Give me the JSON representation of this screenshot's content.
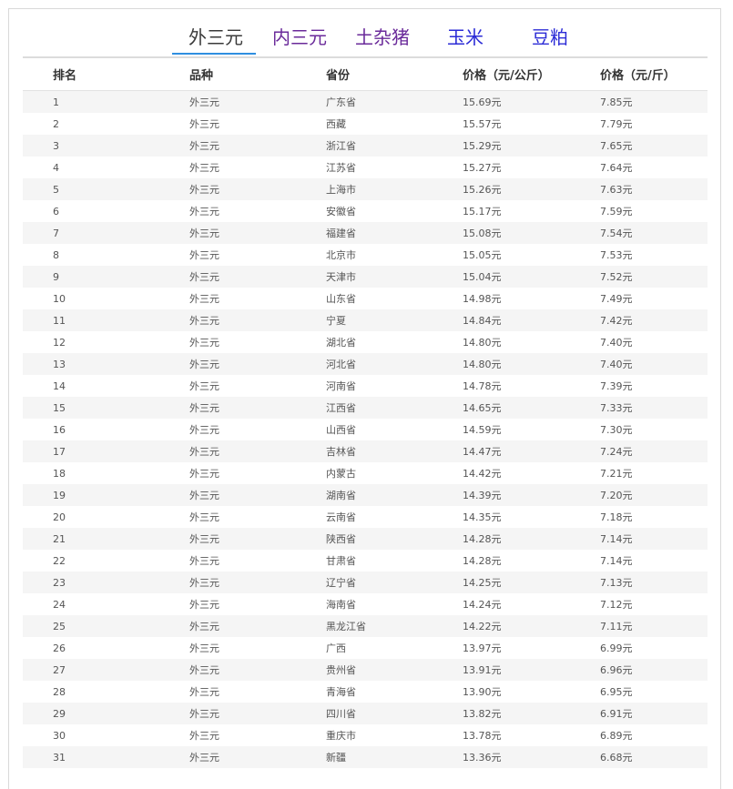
{
  "tabs": [
    {
      "label": "外三元"
    },
    {
      "label": "内三元"
    },
    {
      "label": "土杂猪"
    },
    {
      "label": "玉米"
    },
    {
      "label": "豆粕"
    }
  ],
  "table": {
    "headers": [
      "排名",
      "品种",
      "省份",
      "价格（元/公斤）",
      "价格（元/斤）"
    ],
    "rows": [
      [
        "1",
        "外三元",
        "广东省",
        "15.69元",
        "7.85元"
      ],
      [
        "2",
        "外三元",
        "西藏",
        "15.57元",
        "7.79元"
      ],
      [
        "3",
        "外三元",
        "浙江省",
        "15.29元",
        "7.65元"
      ],
      [
        "4",
        "外三元",
        "江苏省",
        "15.27元",
        "7.64元"
      ],
      [
        "5",
        "外三元",
        "上海市",
        "15.26元",
        "7.63元"
      ],
      [
        "6",
        "外三元",
        "安徽省",
        "15.17元",
        "7.59元"
      ],
      [
        "7",
        "外三元",
        "福建省",
        "15.08元",
        "7.54元"
      ],
      [
        "8",
        "外三元",
        "北京市",
        "15.05元",
        "7.53元"
      ],
      [
        "9",
        "外三元",
        "天津市",
        "15.04元",
        "7.52元"
      ],
      [
        "10",
        "外三元",
        "山东省",
        "14.98元",
        "7.49元"
      ],
      [
        "11",
        "外三元",
        "宁夏",
        "14.84元",
        "7.42元"
      ],
      [
        "12",
        "外三元",
        "湖北省",
        "14.80元",
        "7.40元"
      ],
      [
        "13",
        "外三元",
        "河北省",
        "14.80元",
        "7.40元"
      ],
      [
        "14",
        "外三元",
        "河南省",
        "14.78元",
        "7.39元"
      ],
      [
        "15",
        "外三元",
        "江西省",
        "14.65元",
        "7.33元"
      ],
      [
        "16",
        "外三元",
        "山西省",
        "14.59元",
        "7.30元"
      ],
      [
        "17",
        "外三元",
        "吉林省",
        "14.47元",
        "7.24元"
      ],
      [
        "18",
        "外三元",
        "内蒙古",
        "14.42元",
        "7.21元"
      ],
      [
        "19",
        "外三元",
        "湖南省",
        "14.39元",
        "7.20元"
      ],
      [
        "20",
        "外三元",
        "云南省",
        "14.35元",
        "7.18元"
      ],
      [
        "21",
        "外三元",
        "陕西省",
        "14.28元",
        "7.14元"
      ],
      [
        "22",
        "外三元",
        "甘肃省",
        "14.28元",
        "7.14元"
      ],
      [
        "23",
        "外三元",
        "辽宁省",
        "14.25元",
        "7.13元"
      ],
      [
        "24",
        "外三元",
        "海南省",
        "14.24元",
        "7.12元"
      ],
      [
        "25",
        "外三元",
        "黑龙江省",
        "14.22元",
        "7.11元"
      ],
      [
        "26",
        "外三元",
        "广西",
        "13.97元",
        "6.99元"
      ],
      [
        "27",
        "外三元",
        "贵州省",
        "13.91元",
        "6.96元"
      ],
      [
        "28",
        "外三元",
        "青海省",
        "13.90元",
        "6.95元"
      ],
      [
        "29",
        "外三元",
        "四川省",
        "13.82元",
        "6.91元"
      ],
      [
        "30",
        "外三元",
        "重庆市",
        "13.78元",
        "6.89元"
      ],
      [
        "31",
        "外三元",
        "新疆",
        "13.36元",
        "6.68元"
      ]
    ]
  }
}
